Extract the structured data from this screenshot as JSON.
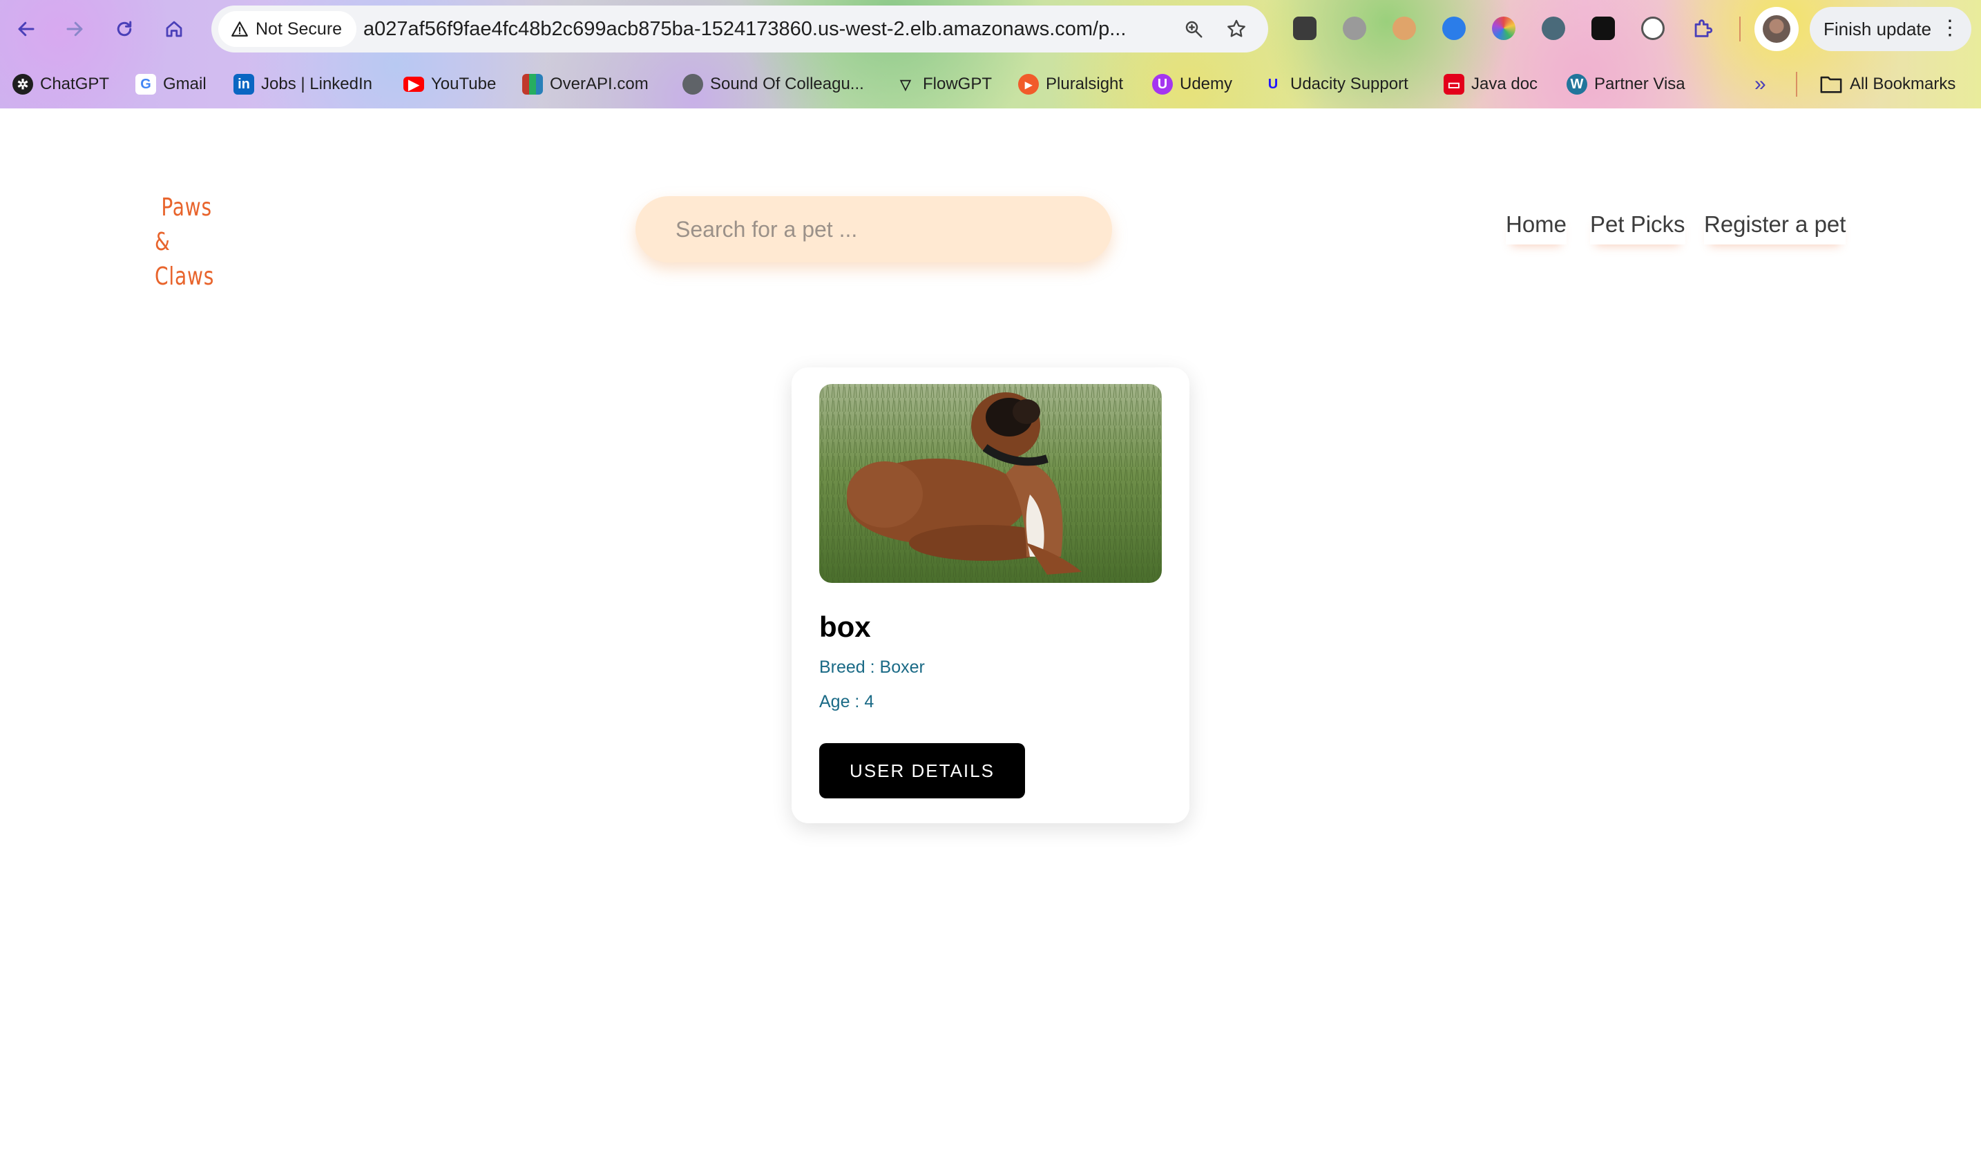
{
  "browser": {
    "security_label": "Not Secure",
    "url": "a027af56f9fae4fc48b2c699acb875ba-1524173860.us-west-2.elb.amazonaws.com/p...",
    "finish_update_label": "Finish update",
    "extensions": [
      "selenium-ide-icon",
      "screenshot-icon",
      "glasses-extension-icon",
      "speechify-icon",
      "chrome-color-icon",
      "grammar-icon",
      "chatgpt-extension-icon",
      "timer-icon",
      "extensions-puzzle-icon"
    ]
  },
  "bookmarks": [
    {
      "label": "ChatGPT",
      "icon": "chatgpt-icon",
      "color": "#1f1f1f"
    },
    {
      "label": "Gmail",
      "icon": "google-icon",
      "color": "#4285f4"
    },
    {
      "label": "Jobs | LinkedIn",
      "icon": "linkedin-icon",
      "color": "#0a66c2"
    },
    {
      "label": "YouTube",
      "icon": "youtube-icon",
      "color": "#ff0000"
    },
    {
      "label": "OverAPI.com",
      "icon": "overapi-icon",
      "color": "#c0392b"
    },
    {
      "label": "Sound Of Colleagu...",
      "icon": "globe-icon",
      "color": "#5f6368"
    },
    {
      "label": "FlowGPT",
      "icon": "flowgpt-icon",
      "color": "#1f1f1f"
    },
    {
      "label": "Pluralsight",
      "icon": "pluralsight-icon",
      "color": "#f15b2a"
    },
    {
      "label": "Udemy",
      "icon": "udemy-icon",
      "color": "#a435f0"
    },
    {
      "label": "Udacity Support",
      "icon": "udacity-icon",
      "color": "#2015ff"
    },
    {
      "label": "Java doc",
      "icon": "oracle-icon",
      "color": "#e3001b"
    },
    {
      "label": "Partner Visa",
      "icon": "wordpress-icon",
      "color": "#21759b"
    }
  ],
  "bookmarks_more": "»",
  "all_bookmarks_label": "All Bookmarks",
  "site": {
    "logo_line1": "Paws",
    "logo_line2": "& Claws",
    "search_placeholder": "Search for a pet ...",
    "nav": [
      "Home",
      "Pet Picks",
      "Register a pet"
    ],
    "accent": "#e8642c"
  },
  "pet": {
    "name": "box",
    "breed_text": "Breed : Boxer",
    "age_text": "Age : 4",
    "button_label": "USER DETAILS"
  }
}
